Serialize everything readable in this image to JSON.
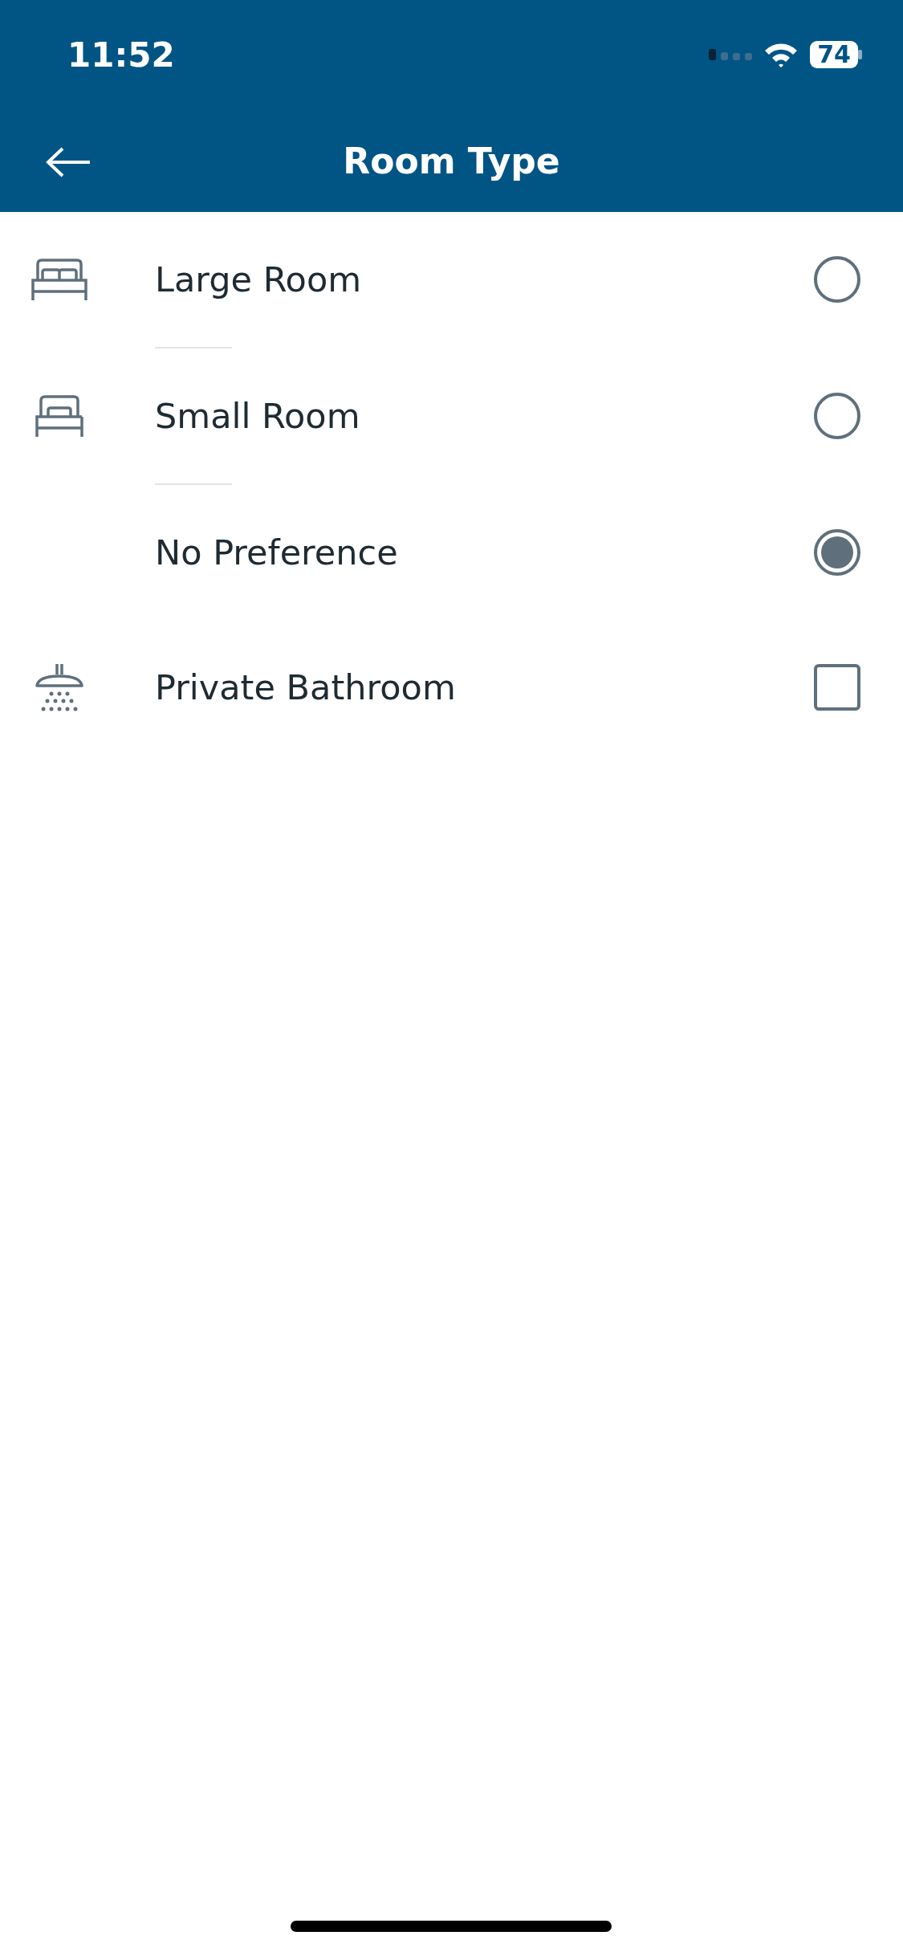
{
  "status_bar": {
    "time": "11:52",
    "battery": "74"
  },
  "nav_bar": {
    "title": "Room Type"
  },
  "options": [
    {
      "label": "Large Room",
      "kind": "radio",
      "selected": false
    },
    {
      "label": "Small Room",
      "kind": "radio",
      "selected": false
    },
    {
      "label": "No Preference",
      "kind": "radio",
      "selected": true
    },
    {
      "label": "Private Bathroom",
      "kind": "checkbox",
      "checked": false
    }
  ]
}
